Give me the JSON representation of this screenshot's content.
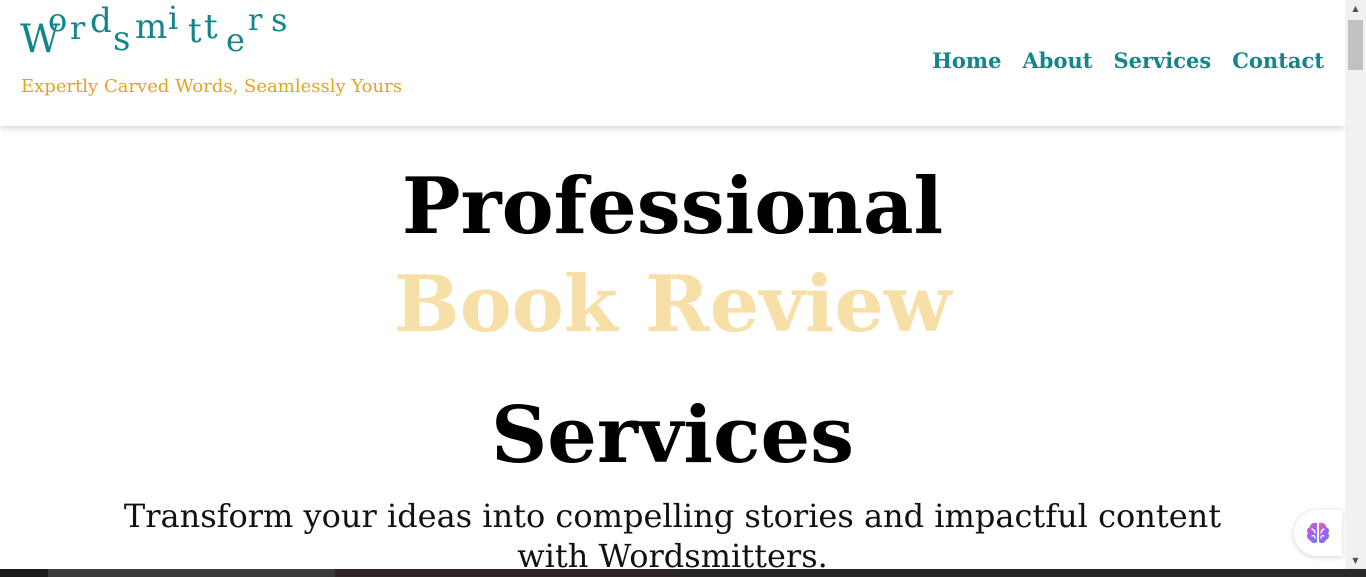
{
  "header": {
    "logo_text": "Wordsmitters",
    "tagline": "Expertly Carved Words, Seamlessly Yours",
    "nav": [
      {
        "label": "Home"
      },
      {
        "label": "About"
      },
      {
        "label": "Services"
      },
      {
        "label": "Contact"
      }
    ]
  },
  "hero": {
    "line1": "Professional",
    "line2": "Book Review",
    "line3": "Services",
    "subtitle": "Transform your ideas into compelling stories and impactful content with Wordsmitters."
  },
  "widget": {
    "icon": "brain-icon"
  },
  "colors": {
    "brand_teal": "#14858a",
    "tagline_gold": "#e3a41c",
    "hero_highlight": "#f7e0a8",
    "text_dark": "#000000"
  }
}
